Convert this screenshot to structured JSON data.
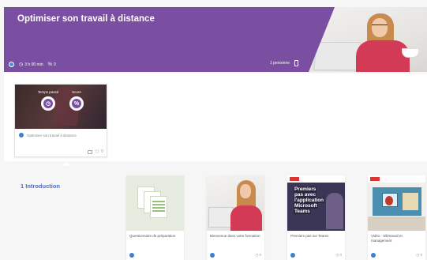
{
  "banner": {
    "title": "Optimiser son travail à distance",
    "duration": "3 h 00 min",
    "score": "0",
    "participants": "1 personne",
    "accent": "#7a4fa1"
  },
  "module": {
    "stat1_label": "Temps passé",
    "stat2_label": "Score",
    "stat2_icon": "%",
    "title": "Optimiser son travail à distance",
    "count": "0"
  },
  "section": {
    "title": "1 Introduction"
  },
  "resources": [
    {
      "title": "Questionnaire de préparation",
      "count": ""
    },
    {
      "title": "Bienvenue dans votre formation",
      "count": "0"
    },
    {
      "title": "Premiers pas sur Teams",
      "count": "0"
    },
    {
      "title": "Vidéo - télétravail et management",
      "count": "0"
    }
  ],
  "teams_thumb": {
    "lines": [
      "Premiers",
      "pas avec",
      "l'application",
      "Microsoft",
      "Teams"
    ]
  },
  "icons": {
    "clock": "clock-icon",
    "percent": "percent-icon",
    "phone": "phone-icon"
  }
}
